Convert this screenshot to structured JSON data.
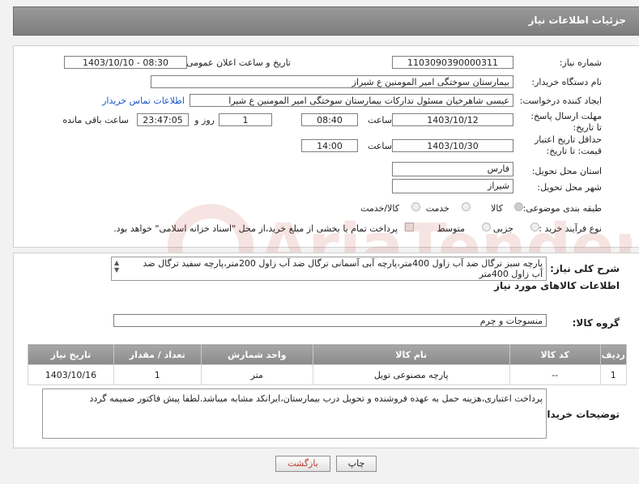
{
  "header": {
    "title": "جزئیات اطلاعات نیاز"
  },
  "fields": {
    "need_number_label": "شماره نیاز:",
    "need_number": "1103090390000311",
    "announce_label": "تاریخ و ساعت اعلان عمومی:",
    "announce_value": "1403/10/10 - 08:30",
    "buyer_label": "نام دستگاه خریدار:",
    "buyer_value": "بیمارستان سوختگی امیر المومنین  ع  شیراز",
    "creator_label": "ایجاد کننده درخواست:",
    "creator_value": "عیسی  شاهرخیان مسئول تدارکات بیمارستان سوختگی امیر المومنین  ع  شیرا",
    "contact_link": "اطلاعات تماس خریدار",
    "deadline_label": "مهلت ارسال پاسخ: تا تاریخ:",
    "deadline_date": "1403/10/12",
    "time_label": "ساعت",
    "deadline_time": "08:40",
    "days_value": "1",
    "days_label": "روز و",
    "remaining_time": "23:47:05",
    "remaining_label": "ساعت باقی مانده",
    "validity_label": "حداقل تاریخ اعتبار قیمت: تا تاریخ:",
    "validity_date": "1403/10/30",
    "validity_time": "14:00",
    "province_label": "استان محل تحویل:",
    "province_value": "فارس",
    "city_label": "شهر محل تحویل:",
    "city_value": "شیراز",
    "category_label": "طبقه بندی موضوعی:",
    "category_options": [
      "کالا",
      "خدمت",
      "کالا/خدمت"
    ],
    "purchase_label": "نوع فرآیند خرید :",
    "purchase_options": [
      "جزیی",
      "متوسط"
    ],
    "payment_note": "پرداخت تمام یا بخشی از مبلغ خرید،از محل \"اسناد خزانه اسلامی\" خواهد بود."
  },
  "description": {
    "label": "شرح کلی نیاز:",
    "text": "پارچه سبز ترگال ضد آب زاول  400متر،پارچه آبی آسمانی ترگال ضد آب  زاول 200متر،پارچه سفید ترگال ضد آب زاول 400متر"
  },
  "goods": {
    "section_title": "اطلاعات کالاهای مورد نیاز",
    "group_label": "گروه کالا:",
    "group_value": "منسوجات و چرم",
    "columns": [
      "ردیف",
      "کد کالا",
      "نام کالا",
      "واحد شمارش",
      "تعداد / مقدار",
      "تاریخ نیاز"
    ],
    "rows": [
      {
        "index": "1",
        "code": "--",
        "name": "پارچه مصنوعی تویل",
        "unit": "متر",
        "qty": "1",
        "date": "1403/10/16"
      }
    ]
  },
  "buyer_notes": {
    "label": "توضیحات خریدار:",
    "text": "پرداخت اعتباری،هزینه حمل به عهده فروشنده و تحویل درب بیمارستان،ایرانکد مشابه میباشد.لطفا پیش فاکتور ضمیمه گردد"
  },
  "buttons": {
    "print": "چاپ",
    "back": "بازگشت"
  },
  "watermark": "AriaTender.neT",
  "colors": {
    "header": "#8a8a8a",
    "link": "#1a56c8",
    "back_text": "#c0392b",
    "watermark": "#c0392b"
  }
}
